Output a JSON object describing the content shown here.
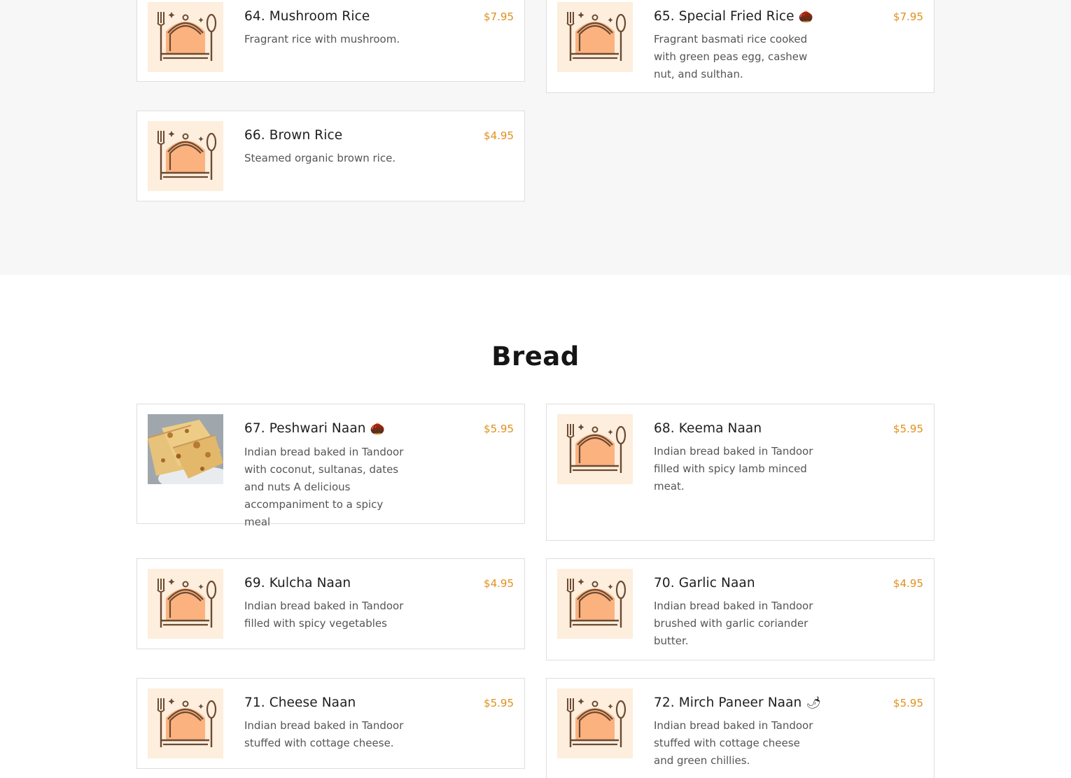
{
  "colors": {
    "price": "#e0901d",
    "accent_thumb_bg": "#fdeedd",
    "cloche": "#fbb27f",
    "outline": "#6b4a33"
  },
  "rice_items": [
    {
      "title": "64. Mushroom Rice",
      "badge": "",
      "price": "$7.95",
      "desc": "Fragrant rice with mushroom.",
      "image": "placeholder-cloche-icon"
    },
    {
      "title": "65. Special Fried Rice",
      "badge": "nut-icon",
      "price": "$7.95",
      "desc": "Fragrant basmati rice cooked with green peas egg, cashew nut, and sulthan.",
      "image": "placeholder-cloche-icon"
    },
    {
      "title": "66. Brown Rice",
      "badge": "",
      "price": "$4.95",
      "desc": "Steamed organic brown rice.",
      "image": "placeholder-cloche-icon"
    }
  ],
  "bread": {
    "heading": "Bread",
    "items": [
      {
        "title": "67. Peshwari Naan",
        "badge": "nut-icon",
        "price": "$5.95",
        "desc": "Indian bread baked in Tandoor with coconut, sultanas, dates and nuts A delicious accompaniment to a spicy meal",
        "image": "naan-photo"
      },
      {
        "title": "68. Keema Naan",
        "badge": "",
        "price": "$5.95",
        "desc": "Indian bread baked in Tandoor filled with spicy lamb minced meat.",
        "image": "placeholder-cloche-icon"
      },
      {
        "title": "69. Kulcha Naan",
        "badge": "",
        "price": "$4.95",
        "desc": "Indian bread baked in Tandoor filled with spicy vegetables",
        "image": "placeholder-cloche-icon"
      },
      {
        "title": "70. Garlic Naan",
        "badge": "",
        "price": "$4.95",
        "desc": "Indian bread baked in Tandoor brushed with garlic coriander butter.",
        "image": "placeholder-cloche-icon"
      },
      {
        "title": "71. Cheese Naan",
        "badge": "",
        "price": "$5.95",
        "desc": "Indian bread baked in Tandoor stuffed with cottage cheese.",
        "image": "placeholder-cloche-icon"
      },
      {
        "title": "72. Mirch Paneer Naan",
        "badge": "chili-icon",
        "price": "$5.95",
        "desc": "Indian bread baked in Tandoor stuffed with cottage cheese and green chillies.",
        "image": "placeholder-cloche-icon"
      }
    ]
  }
}
